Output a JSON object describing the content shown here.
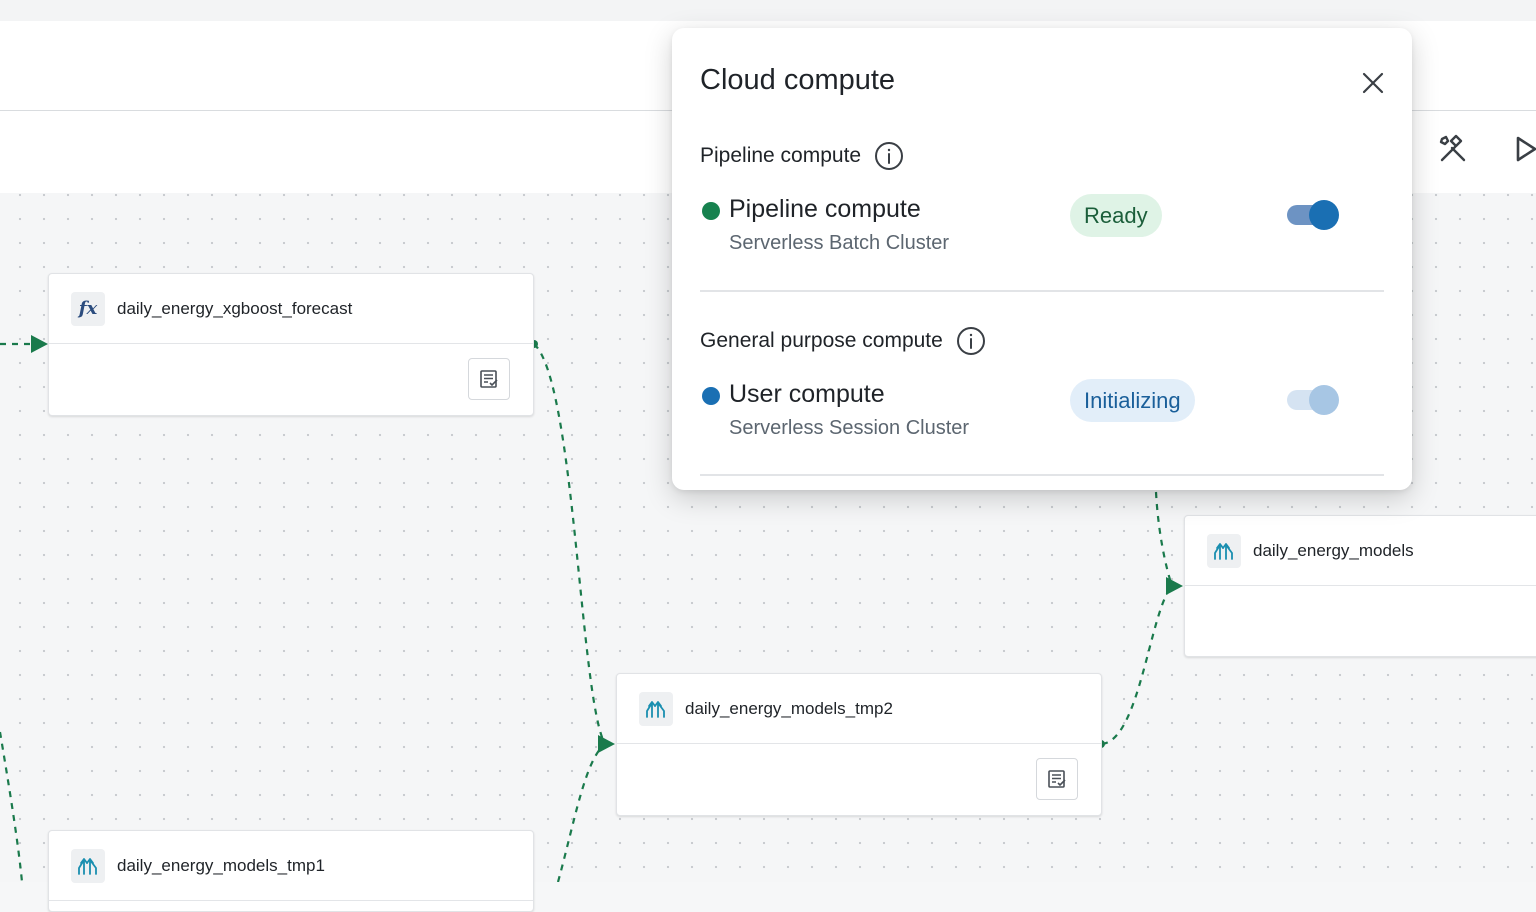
{
  "modal": {
    "title": "Cloud compute",
    "sections": [
      {
        "label": "Pipeline compute",
        "compute": {
          "name": "Pipeline compute",
          "subtitle": "Serverless Batch Cluster",
          "status": "Ready",
          "enabled": true
        }
      },
      {
        "label": "General purpose compute",
        "compute": {
          "name": "User compute",
          "subtitle": "Serverless Session Cluster",
          "status": "Initializing",
          "enabled": true
        }
      }
    ]
  },
  "toolbar": {
    "icons": [
      "build-tools-icon",
      "run-icon"
    ]
  },
  "nodes": [
    {
      "title": "daily_energy_xgboost_forecast",
      "icon": "function-icon",
      "has_action": true
    },
    {
      "title": "daily_energy_models_tmp2",
      "icon": "merge-icon",
      "has_action": true
    },
    {
      "title": "daily_energy_models",
      "icon": "merge-icon",
      "has_action": false
    },
    {
      "title": "daily_energy_models_tmp1",
      "icon": "merge-icon",
      "has_action": false
    }
  ],
  "colors": {
    "edge": "#1a7a4c",
    "ready_dot": "#17824f",
    "ready_badge_bg": "#dff3e6",
    "initializing_dot": "#1a6fb3",
    "initializing_badge_bg": "#e2eef9",
    "toggle_on": "#1a6fb3"
  }
}
